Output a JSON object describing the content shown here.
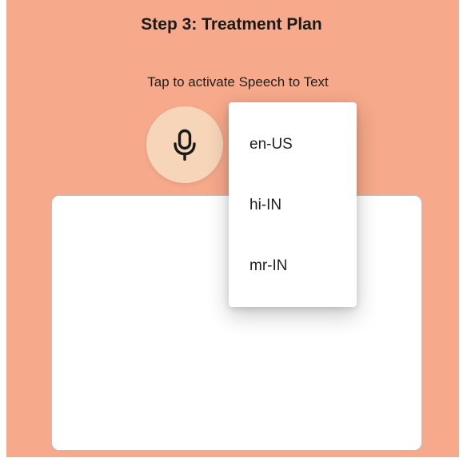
{
  "header": {
    "title": "Step 3: Treatment Plan"
  },
  "speech": {
    "instruction": "Tap to activate Speech to Text",
    "mic_icon": "microphone-icon",
    "text_value": ""
  },
  "language_menu": {
    "items": [
      {
        "label": "en-US"
      },
      {
        "label": "hi-IN"
      },
      {
        "label": "mr-IN"
      }
    ]
  },
  "colors": {
    "background": "#f6a98b",
    "mic_button": "#f7d5b9",
    "card": "#ffffff"
  }
}
